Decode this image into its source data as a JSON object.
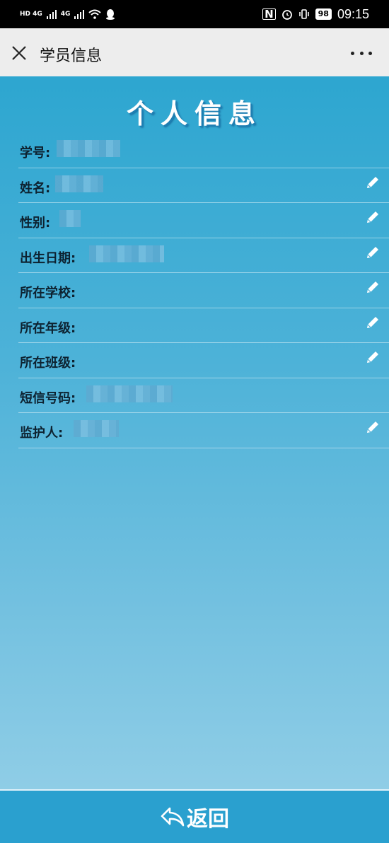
{
  "status_bar": {
    "net1": "HD 4G",
    "net2": "4G",
    "battery": "98",
    "time": "09:15"
  },
  "titlebar": {
    "title": "学员信息"
  },
  "heading": "个人信息",
  "fields": [
    {
      "label": "学号:",
      "editable": false
    },
    {
      "label": "姓名:",
      "editable": true
    },
    {
      "label": "性别:",
      "editable": true
    },
    {
      "label": "出生日期:",
      "editable": true
    },
    {
      "label": "所在学校:",
      "editable": true
    },
    {
      "label": "所在年级:",
      "editable": true
    },
    {
      "label": "所在班级:",
      "editable": true
    },
    {
      "label": "短信号码:",
      "editable": false
    },
    {
      "label": "监护人:",
      "editable": true
    }
  ],
  "footer": {
    "back_label": "返回"
  },
  "colors": {
    "accent": "#2aa0cf",
    "highlight": "#f0dc28"
  }
}
